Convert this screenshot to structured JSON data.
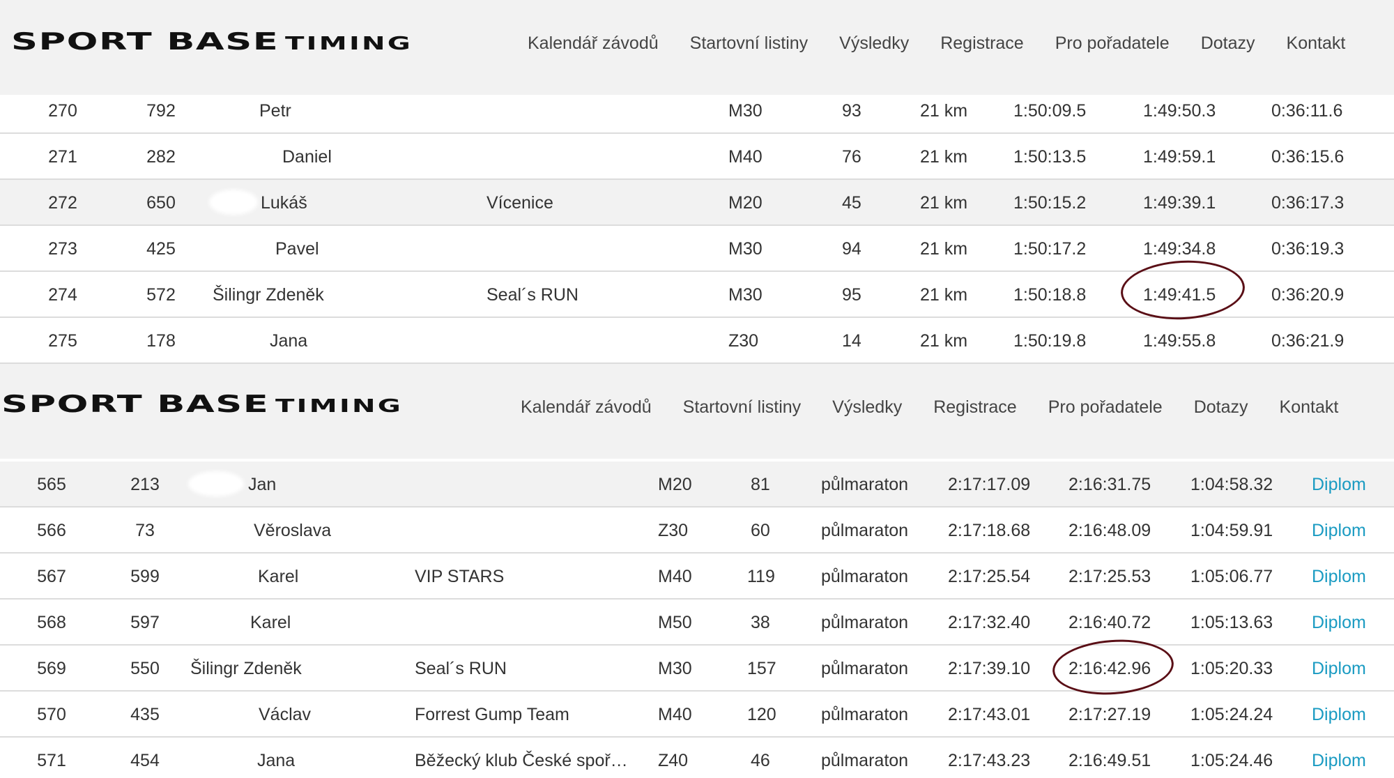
{
  "app": {
    "logo_big": "SPORT BASE",
    "logo_small": "TIMING"
  },
  "nav": [
    "Kalendář závodů",
    "Startovní listiny",
    "Výsledky",
    "Registrace",
    "Pro pořadatele",
    "Dotazy",
    "Kontakt"
  ],
  "colors": {
    "link": "#1a9bc2",
    "highlight_row": "#f2f2f2",
    "header_bg": "#f2f2f2",
    "annotation": "#5a0f16"
  },
  "results_top": {
    "rows": [
      {
        "rank": "270",
        "bib": "792",
        "name": "Petr",
        "club": "",
        "category": "M30",
        "cat_rank": "93",
        "distance": "21 km",
        "time": "1:50:09.5",
        "net_time": "1:49:50.3",
        "loss": "0:36:11.6"
      },
      {
        "rank": "271",
        "bib": "282",
        "name": "Daniel",
        "club": "",
        "category": "M40",
        "cat_rank": "76",
        "distance": "21 km",
        "time": "1:50:13.5",
        "net_time": "1:49:59.1",
        "loss": "0:36:15.6"
      },
      {
        "rank": "272",
        "bib": "650",
        "name": "Lukáš",
        "club": "Vícenice",
        "category": "M20",
        "cat_rank": "45",
        "distance": "21 km",
        "time": "1:50:15.2",
        "net_time": "1:49:39.1",
        "loss": "0:36:17.3"
      },
      {
        "rank": "273",
        "bib": "425",
        "name": "Pavel",
        "club": "",
        "category": "M30",
        "cat_rank": "94",
        "distance": "21 km",
        "time": "1:50:17.2",
        "net_time": "1:49:34.8",
        "loss": "0:36:19.3"
      },
      {
        "rank": "274",
        "bib": "572",
        "name": "Šilingr Zdeněk",
        "club": "Seal´s RUN",
        "category": "M30",
        "cat_rank": "95",
        "distance": "21 km",
        "time": "1:50:18.8",
        "net_time": "1:49:41.5",
        "loss": "0:36:20.9"
      },
      {
        "rank": "275",
        "bib": "178",
        "name": "Jana",
        "club": "",
        "category": "Z30",
        "cat_rank": "14",
        "distance": "21 km",
        "time": "1:50:19.8",
        "net_time": "1:49:55.8",
        "loss": "0:36:21.9"
      }
    ]
  },
  "results_bottom": {
    "rows": [
      {
        "rank": "565",
        "bib": "213",
        "name": "Jan",
        "club": "",
        "category": "M20",
        "cat_rank": "81",
        "distance": "půlmaraton",
        "time": "2:17:17.09",
        "net_time": "2:16:31.75",
        "loss": "1:04:58.32",
        "link": "Diplom"
      },
      {
        "rank": "566",
        "bib": "73",
        "name": "Věroslava",
        "club": "",
        "category": "Z30",
        "cat_rank": "60",
        "distance": "půlmaraton",
        "time": "2:17:18.68",
        "net_time": "2:16:48.09",
        "loss": "1:04:59.91",
        "link": "Diplom"
      },
      {
        "rank": "567",
        "bib": "599",
        "name": "Karel",
        "club": "VIP STARS",
        "category": "M40",
        "cat_rank": "119",
        "distance": "půlmaraton",
        "time": "2:17:25.54",
        "net_time": "2:17:25.53",
        "loss": "1:05:06.77",
        "link": "Diplom"
      },
      {
        "rank": "568",
        "bib": "597",
        "name": "Karel",
        "club": "",
        "category": "M50",
        "cat_rank": "38",
        "distance": "půlmaraton",
        "time": "2:17:32.40",
        "net_time": "2:16:40.72",
        "loss": "1:05:13.63",
        "link": "Diplom"
      },
      {
        "rank": "569",
        "bib": "550",
        "name": "Šilingr Zdeněk",
        "club": "Seal´s RUN",
        "category": "M30",
        "cat_rank": "157",
        "distance": "půlmaraton",
        "time": "2:17:39.10",
        "net_time": "2:16:42.96",
        "loss": "1:05:20.33",
        "link": "Diplom"
      },
      {
        "rank": "570",
        "bib": "435",
        "name": "Václav",
        "club": "Forrest Gump Team",
        "category": "M40",
        "cat_rank": "120",
        "distance": "půlmaraton",
        "time": "2:17:43.01",
        "net_time": "2:17:27.19",
        "loss": "1:05:24.24",
        "link": "Diplom"
      },
      {
        "rank": "571",
        "bib": "454",
        "name": "Jana",
        "club": "Běžecký klub České spoř…",
        "category": "Z40",
        "cat_rank": "46",
        "distance": "půlmaraton",
        "time": "2:17:43.23",
        "net_time": "2:16:49.51",
        "loss": "1:05:24.46",
        "link": "Diplom"
      }
    ]
  }
}
